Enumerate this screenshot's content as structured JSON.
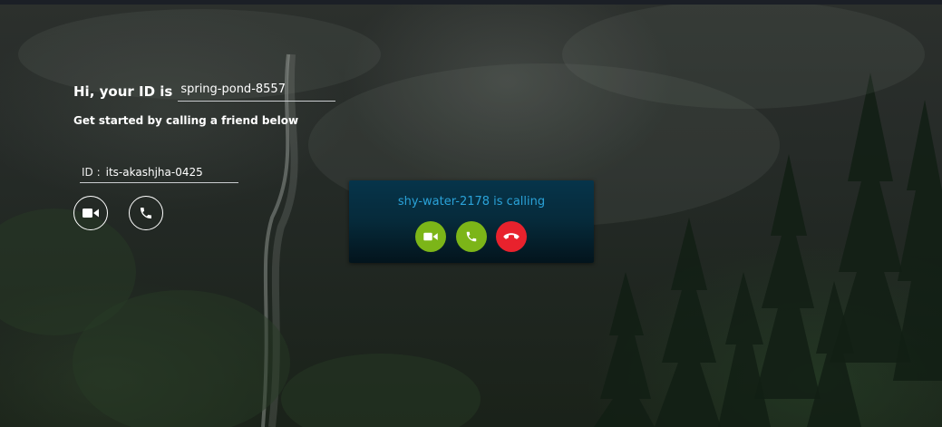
{
  "greeting": {
    "label": "Hi, your ID is",
    "my_id": "spring-pond-8557"
  },
  "subtitle": "Get started by calling a friend below",
  "call_form": {
    "prefix": "ID :",
    "friend_id": "its-akashjha-0425",
    "video_icon": "video-camera-icon",
    "phone_icon": "phone-icon"
  },
  "incoming_call": {
    "message": "shy-water-2178 is calling",
    "accept_video_icon": "video-camera-icon",
    "accept_audio_icon": "phone-icon",
    "reject_icon": "hang-up-icon",
    "colors": {
      "accept": "#7cb518",
      "reject": "#e8222d",
      "text": "#2aa2d8"
    }
  }
}
